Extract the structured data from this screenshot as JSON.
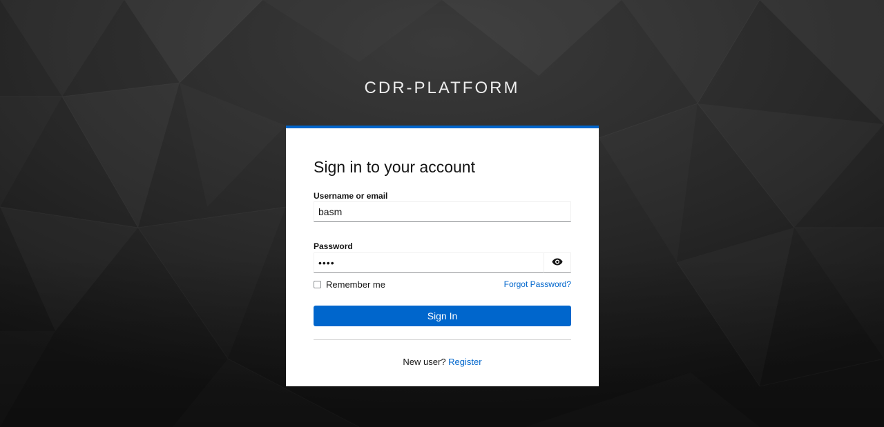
{
  "realm": {
    "title": "CDR-PLATFORM"
  },
  "login": {
    "heading": "Sign in to your account",
    "username": {
      "label": "Username or email",
      "value": "basm"
    },
    "password": {
      "label": "Password",
      "value": "abcd"
    },
    "toggle_password_icon": "eye-icon",
    "remember_me": {
      "label": "Remember me",
      "checked": false
    },
    "forgot_password": "Forgot Password?",
    "submit_label": "Sign In",
    "register_prompt": "New user?",
    "register_link": "Register"
  },
  "colors": {
    "accent": "#0066cc",
    "background": "#1f1f1f",
    "card": "#ffffff"
  }
}
